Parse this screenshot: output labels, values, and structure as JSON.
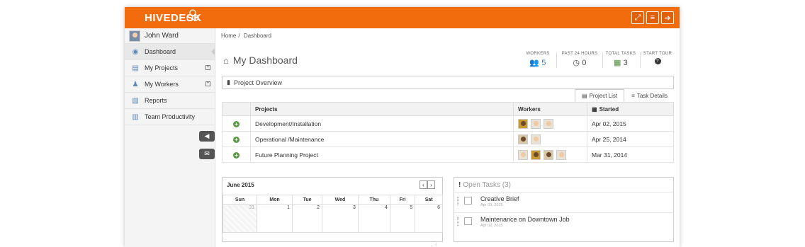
{
  "brand": {
    "name_part1": "HIVE",
    "name_part2": "DESK"
  },
  "topbar": {
    "fullscreen_icon": "expand-icon",
    "menu_icon": "menu-icon",
    "logout_icon": "logout-icon"
  },
  "sidebar": {
    "user_name": "John Ward",
    "items": [
      {
        "label": "Dashboard",
        "icon": "dashboard-icon"
      },
      {
        "label": "My Projects",
        "icon": "document-icon"
      },
      {
        "label": "My Workers",
        "icon": "worker-icon"
      },
      {
        "label": "Reports",
        "icon": "pdf-icon"
      },
      {
        "label": "Team Productivity",
        "icon": "chart-icon"
      }
    ]
  },
  "breadcrumb": {
    "home": "Home",
    "separator": "/",
    "current": "Dashboard"
  },
  "page": {
    "title": "My Dashboard"
  },
  "stats": [
    {
      "label": "WORKERS",
      "value": "5"
    },
    {
      "label": "PAST 24 HOURS",
      "value": "0"
    },
    {
      "label": "TOTAL TASKS",
      "value": "3"
    },
    {
      "label": "START TOUR",
      "value": ""
    }
  ],
  "overview": {
    "title": "Project Overview",
    "tabs": [
      "Project List",
      "Task Details"
    ],
    "columns": [
      "Projects",
      "Workers",
      "Started"
    ],
    "rows": [
      {
        "project": "Development/Installation",
        "workers": 3,
        "started": "Apr 02, 2015"
      },
      {
        "project": "Operational /Maintenance",
        "workers": 2,
        "started": "Apr 25, 2014"
      },
      {
        "project": "Future Planning Project",
        "workers": 4,
        "started": "Mar 31, 2014"
      }
    ]
  },
  "calendar": {
    "month": "June 2015",
    "days": [
      "Sun",
      "Mon",
      "Tue",
      "Wed",
      "Thu",
      "Fri",
      "Sat"
    ],
    "dates": [
      "31",
      "1",
      "2",
      "3",
      "4",
      "5",
      "6"
    ]
  },
  "tasks": {
    "header": "Open Tasks",
    "count": "(3)",
    "items": [
      {
        "title": "Creative Brief",
        "date": "Apr 03, 2015"
      },
      {
        "title": "Maintenance on Downtown Job",
        "date": "Apr 02, 2015"
      }
    ]
  }
}
